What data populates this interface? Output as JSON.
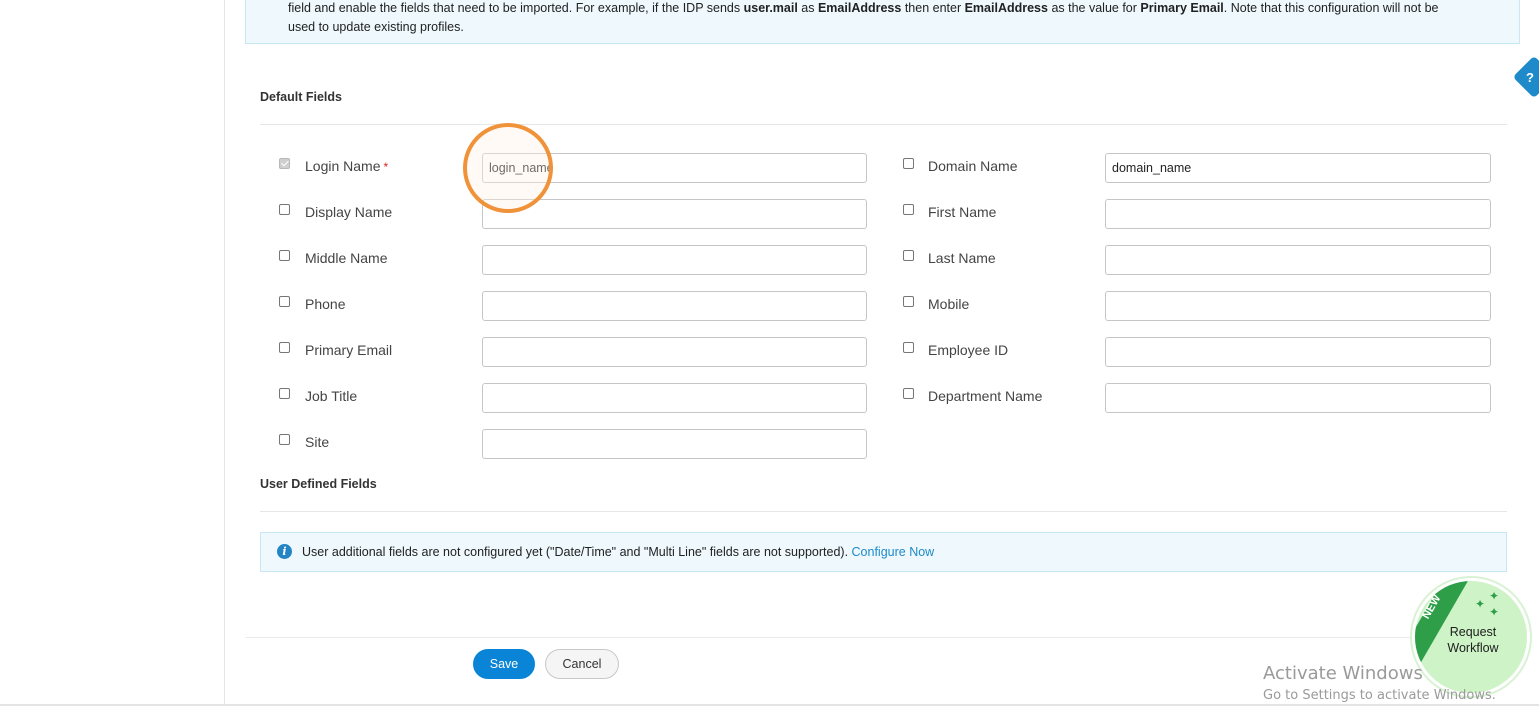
{
  "banner": {
    "line1_parts": [
      {
        "t": "field and enable the fields that need to be imported. For example, if the IDP sends ",
        "b": false
      },
      {
        "t": "user.mail",
        "b": true
      },
      {
        "t": " as ",
        "b": false
      },
      {
        "t": "EmailAddress",
        "b": true
      },
      {
        "t": " then enter ",
        "b": false
      },
      {
        "t": "EmailAddress",
        "b": true
      },
      {
        "t": " as the value for ",
        "b": false
      },
      {
        "t": "Primary Email",
        "b": true
      },
      {
        "t": ". Note that this configuration will not be",
        "b": false
      }
    ],
    "line2": "used to update existing profiles."
  },
  "default_fields": {
    "title": "Default Fields",
    "left": [
      {
        "name": "login-name",
        "label": "Login Name",
        "required_mark": "*",
        "checked": true,
        "disabled": true,
        "value": "login_name"
      },
      {
        "name": "display-name",
        "label": "Display Name",
        "checked": false,
        "value": ""
      },
      {
        "name": "middle-name",
        "label": "Middle Name",
        "checked": false,
        "value": ""
      },
      {
        "name": "phone",
        "label": "Phone",
        "checked": false,
        "value": ""
      },
      {
        "name": "primary-email",
        "label": "Primary Email",
        "checked": false,
        "value": ""
      },
      {
        "name": "job-title",
        "label": "Job Title",
        "checked": false,
        "value": ""
      },
      {
        "name": "site",
        "label": "Site",
        "checked": false,
        "value": ""
      }
    ],
    "right": [
      {
        "name": "domain-name",
        "label": "Domain Name",
        "checked": false,
        "value": "domain_name"
      },
      {
        "name": "first-name",
        "label": "First Name",
        "checked": false,
        "value": ""
      },
      {
        "name": "last-name",
        "label": "Last Name",
        "checked": false,
        "value": ""
      },
      {
        "name": "mobile",
        "label": "Mobile",
        "checked": false,
        "value": ""
      },
      {
        "name": "employee-id",
        "label": "Employee ID",
        "checked": false,
        "value": ""
      },
      {
        "name": "department-name",
        "label": "Department Name",
        "checked": false,
        "value": ""
      }
    ]
  },
  "user_defined": {
    "title": "User Defined Fields",
    "message": "User additional fields are not configured yet (\"Date/Time\" and \"Multi Line\" fields are not supported).",
    "link": "Configure Now"
  },
  "buttons": {
    "save": "Save",
    "cancel": "Cancel"
  },
  "help_label": "?",
  "request_workflow": {
    "badge": "NEW",
    "line1": "Request",
    "line2": "Workflow"
  },
  "watermark": {
    "title": "Activate Windows",
    "subtitle": "Go to Settings to activate Windows."
  },
  "colors": {
    "accent": "#0a84d6",
    "link": "#1f8ac9",
    "info_bg": "#eef8fd",
    "highlight": "#f0923a",
    "workflow_green": "#2e9e48"
  },
  "icons": [
    "info-icon",
    "help-icon",
    "sparkle-icon"
  ]
}
